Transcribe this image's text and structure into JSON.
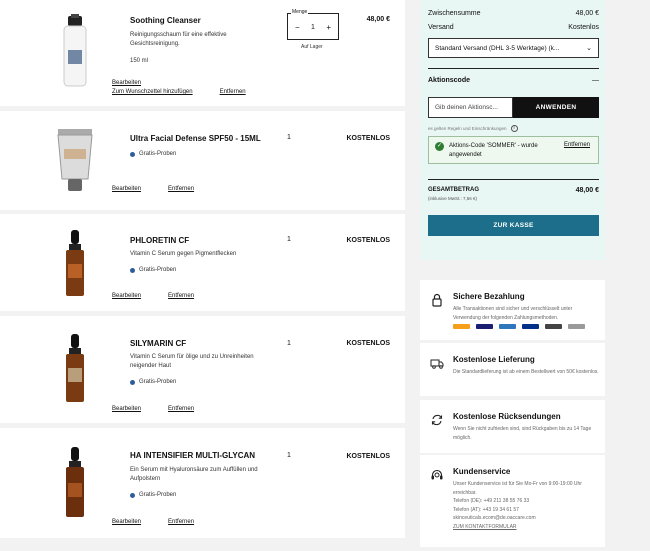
{
  "cart": {
    "items": [
      {
        "name": "Soothing Cleanser",
        "description": "Reinigungsschaum für eine effektive Gesichtsreinigung.",
        "size": "150 ml",
        "quantity_label": "Menge",
        "quantity": "1",
        "stock": "Auf Lager",
        "price": "48,00 €",
        "links": [
          "Bearbeiten",
          "Zum Wunschzettel hinzufügen",
          "Entfernen"
        ]
      },
      {
        "name": "Ultra Facial Defense SPF50 - 15ML",
        "badge": "Gratis-Proben",
        "quantity": "1",
        "price": "KOSTENLOS",
        "links": [
          "Bearbeiten",
          "Entfernen"
        ]
      },
      {
        "name": "PHLORETIN CF",
        "description": "Vitamin C Serum gegen Pigmentflecken",
        "badge": "Gratis-Proben",
        "quantity": "1",
        "price": "KOSTENLOS",
        "links": [
          "Bearbeiten",
          "Entfernen"
        ]
      },
      {
        "name": "SILYMARIN CF",
        "description": "Vitamin C Serum für ölige und zu Unreinheiten neigender Haut",
        "badge": "Gratis-Proben",
        "quantity": "1",
        "price": "KOSTENLOS",
        "links": [
          "Bearbeiten",
          "Entfernen"
        ]
      },
      {
        "name": "HA INTENSIFIER MULTI-GLYCAN",
        "description": "Ein Serum mit Hyaluronsäure zum Auffüllen und Aufpolstern",
        "badge": "Gratis-Proben",
        "quantity": "1",
        "price": "KOSTENLOS",
        "links": [
          "Bearbeiten",
          "Entfernen"
        ]
      }
    ]
  },
  "summary": {
    "subtotal_label": "Zwischensumme",
    "subtotal_value": "48,00 €",
    "shipping_label": "Versand",
    "shipping_value": "Kostenlos",
    "shipping_option": "Standard Versand (DHL 3-5 Werktage) (k...",
    "promo_heading": "Aktionscode",
    "promo_toggle": "—",
    "promo_placeholder": "Gib deinen Aktionsc...",
    "promo_button": "ANWENDEN",
    "terms": "es gelten Regeln und Einschränkungen",
    "applied_message": "Aktions-Code 'SOMMER' - wurde angewendet",
    "applied_remove": "Entfernen",
    "total_label": "GESAMTBETRAG",
    "total_sub": "(inklusive MwSt.: 7,66 €)",
    "total_value": "48,00 €",
    "checkout_button": "ZUR KASSE"
  },
  "info": [
    {
      "icon": "lock-icon",
      "title": "Sichere Bezahlung",
      "text": "Alle Transaktionen sind sicher und verschlüsselt unter Verwendung der folgenden Zahlungsmethoden."
    },
    {
      "icon": "truck-icon",
      "title": "Kostenlose Lieferung",
      "text": "Die Standardlieferung ist ab einem Bestellwert von 50€ kostenlos."
    },
    {
      "icon": "return-icon",
      "title": "Kostenlose Rücksendungen",
      "text": "Wenn Sie nicht zufrieden sind, sind Rückgaben bis zu 14 Tage möglich."
    },
    {
      "icon": "headset-icon",
      "title": "Kundenservice",
      "text": "Unser Kundenservice ist für Sie Mo-Fr von 9:00-19:00 Uhr erreichbar.",
      "phone_de": "Telefon (DE): +49 211 38 55 76 33",
      "phone_at": "Telefon (AT): +43 19 34 61 57",
      "email": "skinceuticals.ecom@de.oaccare.com",
      "contact_link": "ZUM KONTAKTFORMULAR"
    }
  ],
  "colors": {
    "summary_bg": "#e9f7f4",
    "checkout": "#1d6e8a",
    "badge_dot": "#2f5d9a",
    "success": "#2e7d32"
  }
}
